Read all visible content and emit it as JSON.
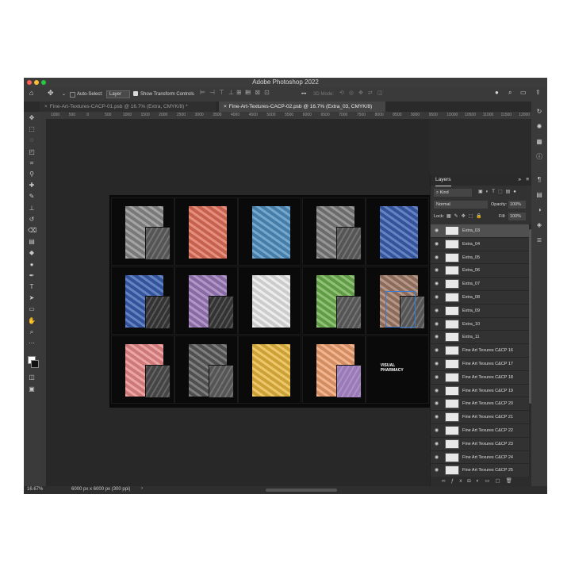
{
  "window": {
    "title": "Adobe Photoshop 2022"
  },
  "options": {
    "auto_select_label": "Auto-Select:",
    "layer_select": "Layer",
    "transform_label": "Show Transform Controls",
    "mode_3d": "3D Mode:",
    "more": "•••"
  },
  "tabs": [
    {
      "label": "Fine-Art-Textures-CACP-01.psb @ 16.7% (Extra, CMYK/8) *"
    },
    {
      "label": "Fine-Art-Textures-CACP-02.psb @ 16.7% (Extra_03, CMYK/8)"
    }
  ],
  "ruler": [
    "1000",
    "500",
    "0",
    "500",
    "1000",
    "1500",
    "2000",
    "2500",
    "3000",
    "3500",
    "4000",
    "4500",
    "5000",
    "5500",
    "6000",
    "6500",
    "7000",
    "7500",
    "8000",
    "8500",
    "9000",
    "9500",
    "10000",
    "10500",
    "11000",
    "11500",
    "12000",
    "12500"
  ],
  "logo": {
    "line1": "VISUAL",
    "line2": "PHARMACY"
  },
  "panel": {
    "title": "Layers",
    "kind": "Kind",
    "blend": "Normal",
    "opacity_label": "Opacity:",
    "opacity": "100%",
    "lock_label": "Lock:",
    "fill_label": "Fill:",
    "fill": "100%"
  },
  "layers": [
    "Extra_03",
    "Extra_04",
    "Extra_05",
    "Extra_06",
    "Extra_07",
    "Extra_08",
    "Extra_09",
    "Extra_10",
    "Extra_11",
    "Fine Art Texures C&CP 16",
    "Fine Art Texures C&CP 17",
    "Fine Art Texures C&CP 18",
    "Fine Art Texures C&CP 19",
    "Fine Art Texures C&CP 20",
    "Fine Art Texures C&CP 21",
    "Fine Art Texures C&CP 22",
    "Fine Art Texures C&CP 23",
    "Fine Art Texures C&CP 24",
    "Fine Art Texures C&CP 25"
  ],
  "status": {
    "zoom": "16.67%",
    "doc": "6000 px x 6000 px (300 ppi)"
  },
  "colors": {
    "cell_grey": "#8a8a8a",
    "cell_red": "#e0705a",
    "cell_blue": "#4f8fc0",
    "cell_lightgrey": "#7a7a7a",
    "cell_navy": "#3a5fb0",
    "cell_purple": "#9a7ab8",
    "cell_white": "#e8e8e8",
    "cell_green": "#6fb050",
    "cell_brown": "#a07a66",
    "cell_pink": "#e88a8a",
    "cell_yellow": "#e8b840",
    "cell_orange": "#f0a070"
  }
}
